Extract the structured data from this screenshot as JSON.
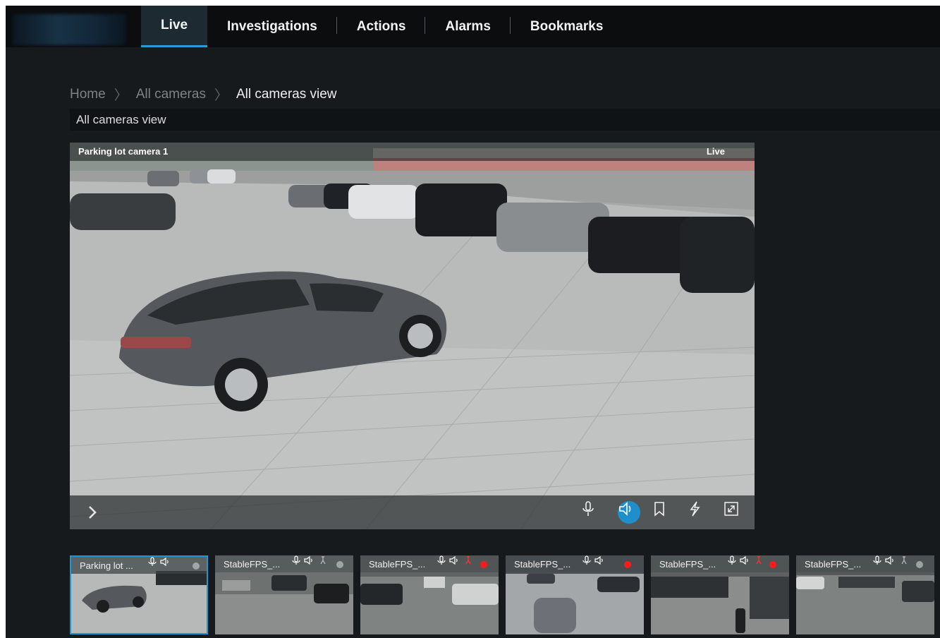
{
  "nav": {
    "items": [
      {
        "label": "Live",
        "active": true
      },
      {
        "label": "Investigations"
      },
      {
        "label": "Actions"
      },
      {
        "label": "Alarms"
      },
      {
        "label": "Bookmarks"
      }
    ]
  },
  "breadcrumb": {
    "items": [
      "Home",
      "All cameras",
      "All cameras view"
    ],
    "separator": "〉"
  },
  "view": {
    "title": "All cameras view"
  },
  "main_video": {
    "camera_name": "Parking lot camera 1",
    "status": "Live"
  },
  "thumbnails": [
    {
      "name": "Parking lot ...",
      "recording": false,
      "selected": true
    },
    {
      "name": "StableFPS_...",
      "recording": false,
      "selected": false
    },
    {
      "name": "StableFPS_...",
      "recording": true,
      "selected": false
    },
    {
      "name": "StableFPS_...",
      "recording": true,
      "selected": false
    },
    {
      "name": "StableFPS_...",
      "recording": true,
      "selected": false
    },
    {
      "name": "StableFPS_...",
      "recording": false,
      "selected": false
    }
  ],
  "colors": {
    "accent": "#2b9bd4",
    "recording": "#ff1a1a",
    "background": "#161a1c"
  },
  "icons": {
    "toolbar": [
      "microphone-icon",
      "speaker-icon",
      "bookmark-icon",
      "lightning-icon",
      "fullscreen-icon"
    ],
    "expand": "chevron-right-icon"
  }
}
